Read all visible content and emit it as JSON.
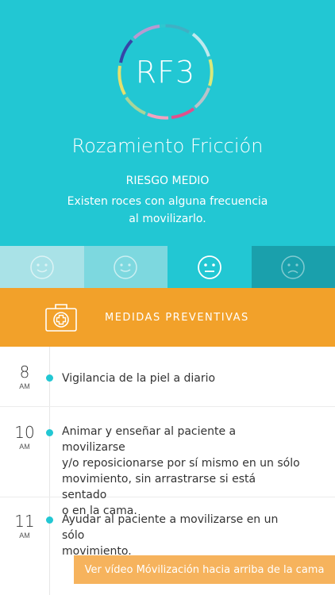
{
  "header": {
    "code": "RF3",
    "title": "Rozamiento Fricción",
    "risk_level": "RIESGO MEDIO",
    "description_line1": "Existen roces con alguna frecuencia",
    "description_line2": "al movilizarlo.",
    "background_color": "#22c7d3"
  },
  "rating": {
    "selected_index": 2,
    "options": [
      {
        "icon": "smile-icon",
        "color": "#a9e2e7"
      },
      {
        "icon": "smile-icon",
        "color": "#7dd8df"
      },
      {
        "icon": "neutral-face-icon",
        "color": "#22c7d3"
      },
      {
        "icon": "sad-face-icon",
        "color": "#1aa0ac"
      }
    ]
  },
  "measures": {
    "icon": "first-aid-kit-icon",
    "label": "MEDIDAS PREVENTIVAS",
    "color": "#f2a12a"
  },
  "schedule": [
    {
      "hour": "8",
      "ampm": "AM",
      "text": "Vigilancia de la piel a diario"
    },
    {
      "hour": "10",
      "ampm": "AM",
      "lines": [
        "Animar y enseñar al paciente a movilizarse",
        "y/o reposicionarse por sí mismo en un sólo",
        "movimiento, sin arrastrarse si está sentado",
        "o en la cama."
      ]
    },
    {
      "hour": "11",
      "ampm": "AM",
      "lines": [
        "Ayudar al paciente a movilizarse en un sólo",
        "movimiento."
      ]
    }
  ],
  "video_button": {
    "label": "Ver vídeo Móvilización hacia arriba de la cama",
    "color": "#f6b35d"
  }
}
